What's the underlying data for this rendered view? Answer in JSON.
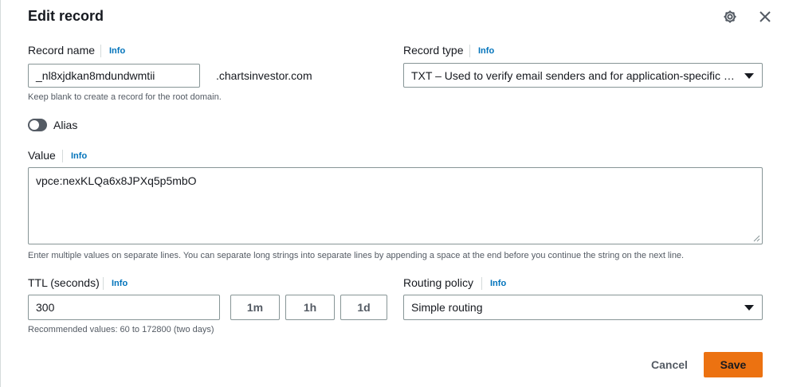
{
  "modal": {
    "title": "Edit record",
    "icons": {
      "settings": "gear-icon",
      "close": "close-icon"
    }
  },
  "record_name": {
    "label": "Record name",
    "info": "Info",
    "value": "_nl8xjdkan8mdundwmtii",
    "domain_suffix": ".chartsinvestor.com",
    "help": "Keep blank to create a record for the root domain."
  },
  "record_type": {
    "label": "Record type",
    "info": "Info",
    "selected": "TXT – Used to verify email senders and for application-specific values"
  },
  "alias": {
    "label": "Alias",
    "enabled": false
  },
  "value": {
    "label": "Value",
    "info": "Info",
    "content": "vpce:nexKLQa6x8JPXq5p5mbO",
    "help": "Enter multiple values on separate lines. You can separate long strings into separate lines by appending a space at the end before you continue the string on the next line."
  },
  "ttl": {
    "label": "TTL (seconds)",
    "info": "Info",
    "value": "300",
    "presets": [
      "1m",
      "1h",
      "1d"
    ],
    "help": "Recommended values: 60 to 172800 (two days)"
  },
  "routing_policy": {
    "label": "Routing policy",
    "info": "Info",
    "selected": "Simple routing"
  },
  "footer": {
    "cancel_label": "Cancel",
    "save_label": "Save"
  },
  "colors": {
    "accent": "#ec7211",
    "link": "#0073bb",
    "border": "#879596",
    "text": "#16191f",
    "muted": "#545b64"
  }
}
